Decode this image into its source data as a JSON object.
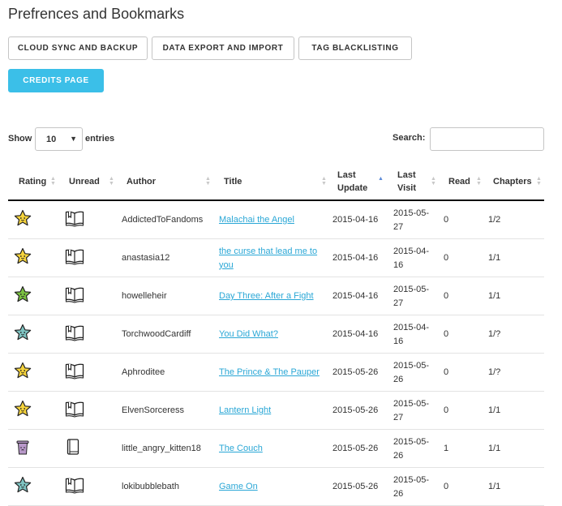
{
  "page": {
    "title": "Prefrences and Bookmarks"
  },
  "buttons": {
    "cloud": "CLOUD SYNC AND BACKUP",
    "export": "DATA EXPORT AND IMPORT",
    "blacklist": "TAG BLACKLISTING",
    "credits": "CREDITS PAGE"
  },
  "controls": {
    "show_label": "Show",
    "length_value": "10",
    "entries_label": "entries",
    "search_label": "Search:"
  },
  "columns": {
    "rating": "Rating",
    "unread": "Unread",
    "author": "Author",
    "title": "Title",
    "last_update": "Last Update",
    "last_visit": "Last Visit",
    "read": "Read",
    "chapters": "Chapters"
  },
  "sorted_column": "last_update",
  "colors": {
    "accent": "#3bbfe8",
    "link": "#2aa7d6",
    "star_yellow": "#f5d33c",
    "star_green": "#7bc142",
    "star_teal": "#7fc4c2",
    "trash_purple": "#b898c9"
  },
  "rows": [
    {
      "rating": "star-yellow-icon",
      "unread": "open-book-icon",
      "author": "AddictedToFandoms",
      "title": "Malachai the Angel",
      "last_update": "2015-04-16",
      "last_visit": "2015-05-27",
      "read": "0",
      "chapters": "1/2"
    },
    {
      "rating": "star-yellow-icon",
      "unread": "open-book-icon",
      "author": "anastasia12",
      "title": "the curse that lead me to you",
      "last_update": "2015-04-16",
      "last_visit": "2015-04-16",
      "read": "0",
      "chapters": "1/1"
    },
    {
      "rating": "star-green-icon",
      "unread": "open-book-icon",
      "author": "howelleheir",
      "title": "Day Three: After a Fight",
      "last_update": "2015-04-16",
      "last_visit": "2015-05-27",
      "read": "0",
      "chapters": "1/1"
    },
    {
      "rating": "star-teal-icon",
      "unread": "open-book-icon",
      "author": "TorchwoodCardiff",
      "title": "You Did What?",
      "last_update": "2015-04-16",
      "last_visit": "2015-04-16",
      "read": "0",
      "chapters": "1/?"
    },
    {
      "rating": "star-yellow-icon",
      "unread": "open-book-icon",
      "author": "Aphroditee",
      "title": "The Prince & The Pauper",
      "last_update": "2015-05-26",
      "last_visit": "2015-05-26",
      "read": "0",
      "chapters": "1/?"
    },
    {
      "rating": "star-yellow-icon",
      "unread": "open-book-icon",
      "author": "ElvenSorceress",
      "title": "Lantern Light",
      "last_update": "2015-05-26",
      "last_visit": "2015-05-27",
      "read": "0",
      "chapters": "1/1"
    },
    {
      "rating": "trash-can-icon",
      "unread": "closed-book-icon",
      "author": "little_angry_kitten18",
      "title": "The Couch",
      "last_update": "2015-05-26",
      "last_visit": "2015-05-26",
      "read": "1",
      "chapters": "1/1"
    },
    {
      "rating": "star-teal-icon",
      "unread": "open-book-icon",
      "author": "lokibubblebath",
      "title": "Game On",
      "last_update": "2015-05-26",
      "last_visit": "2015-05-26",
      "read": "0",
      "chapters": "1/1"
    }
  ]
}
